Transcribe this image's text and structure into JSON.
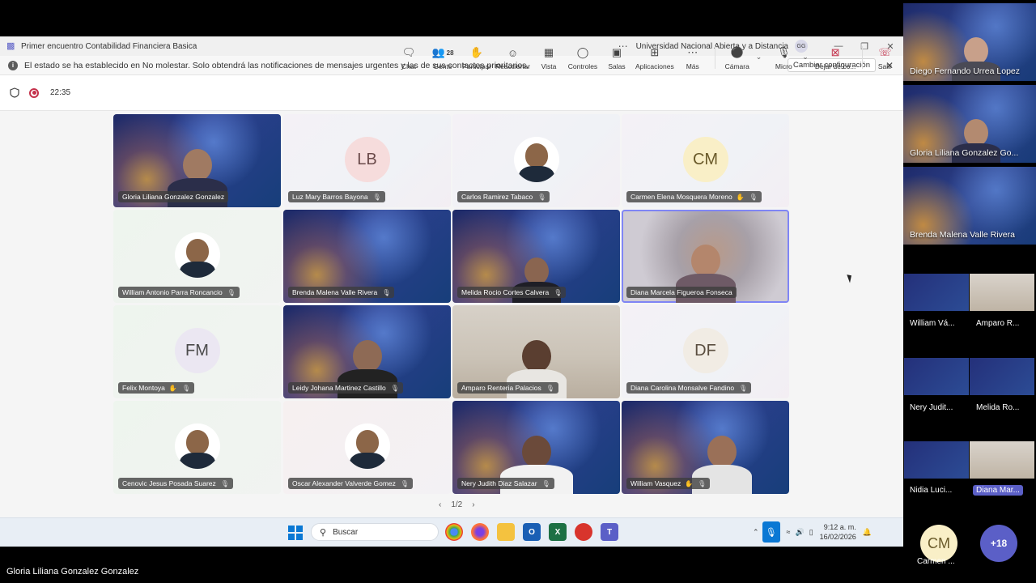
{
  "window": {
    "title": "Primer encuentro Contabilidad Financiera Basica",
    "organization": "Universidad Nacional Abierta y a Distancia",
    "user_initials": "GG"
  },
  "notice": {
    "text": "El estado se ha establecido en No molestar. Solo obtendrá las notificaciones de mensajes urgentes y las de sus contactos prioritarios.",
    "button": "Cambiar configuración"
  },
  "meeting": {
    "timer": "22:35"
  },
  "toolbar": {
    "chat": "Chat",
    "people": "Gente",
    "people_count": "28",
    "raise": "Participar",
    "react": "Reaccionar",
    "view": "Vista",
    "controls": "Controles",
    "rooms": "Salas",
    "apps": "Aplicaciones",
    "more": "Más",
    "camera": "Cámara",
    "mic": "Micro",
    "share": "Dejar de co...",
    "leave": "Salir"
  },
  "tiles": [
    {
      "name": "Gloria Liliana Gonzalez Gonzalez",
      "initials": "",
      "kind": "video"
    },
    {
      "name": "Luz Mary Barros Bayona",
      "initials": "LB",
      "kind": "initials"
    },
    {
      "name": "Carlos Ramirez Tabaco",
      "initials": "",
      "kind": "photo"
    },
    {
      "name": "Carmen Elena Mosquera Moreno",
      "initials": "CM",
      "kind": "initials"
    },
    {
      "name": "William Antonio Parra Roncancio",
      "initials": "",
      "kind": "photo"
    },
    {
      "name": "Brenda Malena Valle Rivera",
      "initials": "",
      "kind": "video"
    },
    {
      "name": "Melida Rocio Cortes Calvera",
      "initials": "",
      "kind": "video"
    },
    {
      "name": "Diana Marcela Figueroa Fonseca",
      "initials": "",
      "kind": "video"
    },
    {
      "name": "Felix Montoya",
      "initials": "FM",
      "kind": "initials"
    },
    {
      "name": "Leidy Johana Martinez Castillo",
      "initials": "",
      "kind": "video"
    },
    {
      "name": "Amparo Renteria Palacios",
      "initials": "",
      "kind": "video"
    },
    {
      "name": "Diana Carolina Monsalve Fandino",
      "initials": "DF",
      "kind": "initials"
    },
    {
      "name": "Cenovic Jesus Posada Suarez",
      "initials": "",
      "kind": "photo"
    },
    {
      "name": "Oscar Alexander Valverde Gomez",
      "initials": "",
      "kind": "photo"
    },
    {
      "name": "Nery Judith Diaz Salazar",
      "initials": "",
      "kind": "video"
    },
    {
      "name": "William Vasquez",
      "initials": "",
      "kind": "video"
    }
  ],
  "pager": {
    "label": "1/2"
  },
  "taskbar": {
    "search_placeholder": "Buscar",
    "time": "9:12 a. m.",
    "date": "16/02/2026"
  },
  "strip": {
    "big": [
      "Diego Fernando Urrea Lopez",
      "Gloria Liliana Gonzalez Go...",
      "Brenda Malena Valle Rivera"
    ],
    "small": [
      "William Vá...",
      "Amparo  R...",
      "Nery Judit...",
      "Melida Ro...",
      "Nidia Luci...",
      "Diana Mar..."
    ],
    "cm_initials": "CM",
    "cm_name": "Carmen ...",
    "more": "+18"
  },
  "bottom_name": "Gloria Liliana Gonzalez Gonzalez"
}
